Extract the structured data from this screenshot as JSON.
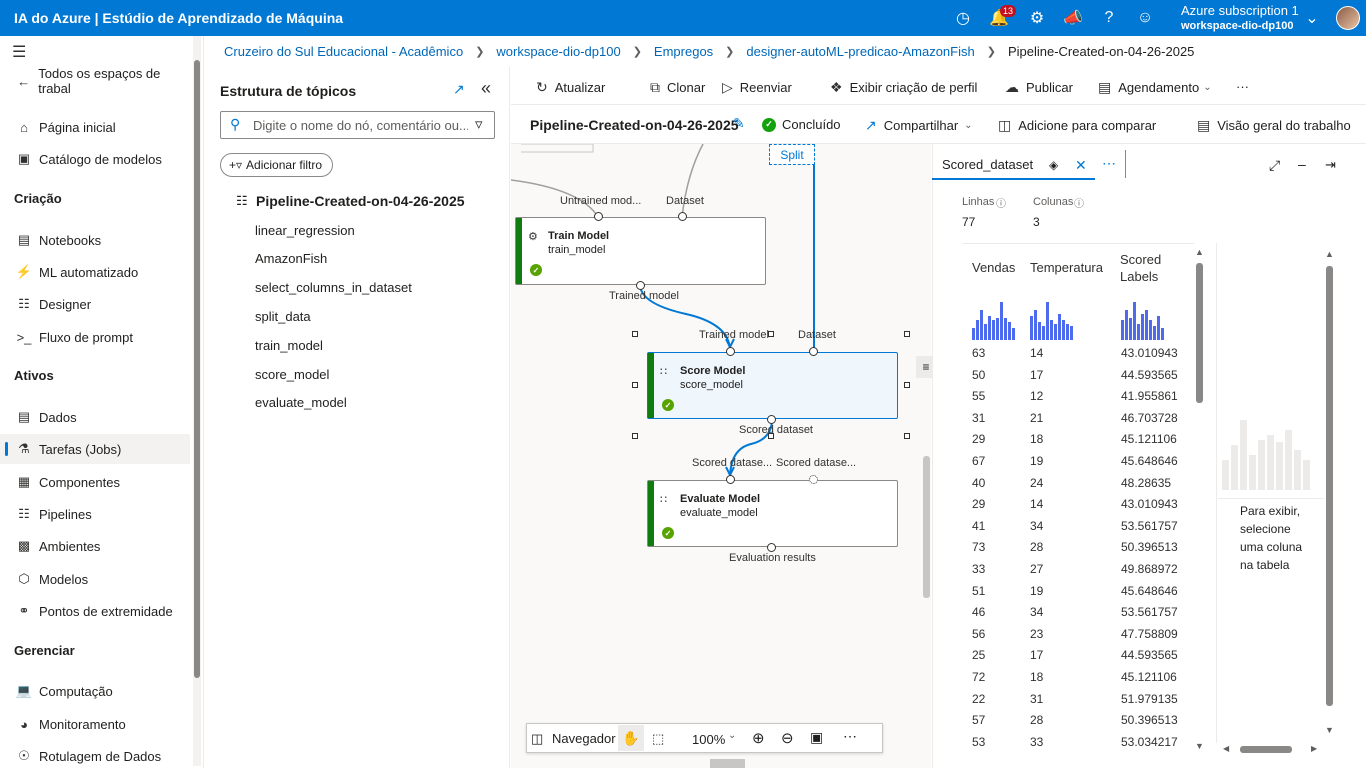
{
  "header": {
    "title": "IA do Azure | Estúdio de Aprendizado de Máquina",
    "notifications_count": "13",
    "subscription": "Azure subscription 1",
    "workspace": "workspace-dio-dp100"
  },
  "nav": {
    "back_label": "Todos os espaços de trabal",
    "home": "Página inicial",
    "catalog": "Catálogo de modelos",
    "section_create": "Criação",
    "notebooks": "Notebooks",
    "automl": "ML automatizado",
    "designer": "Designer",
    "prompt_flow": "Fluxo de prompt",
    "section_assets": "Ativos",
    "data": "Dados",
    "jobs": "Tarefas (Jobs)",
    "components": "Componentes",
    "pipelines": "Pipelines",
    "environments": "Ambientes",
    "models": "Modelos",
    "endpoints": "Pontos de extremidade",
    "section_manage": "Gerenciar",
    "compute": "Computação",
    "monitoring": "Monitoramento",
    "labeling": "Rotulagem de Dados"
  },
  "breadcrumb": {
    "c1": "Cruzeiro do Sul Educacional - Acadêmico",
    "c2": "workspace-dio-dp100",
    "c3": "Empregos",
    "c4": "designer-autoML-predicao-AmazonFish",
    "c5": "Pipeline-Created-on-04-26-2025"
  },
  "outline": {
    "title": "Estrutura de tópicos",
    "search_placeholder": "Digite o nome do nó, comentário ou...",
    "add_filter": "Adicionar filtro",
    "root": "Pipeline-Created-on-04-26-2025",
    "nodes": [
      "linear_regression",
      "AmazonFish",
      "select_columns_in_dataset",
      "split_data",
      "train_model",
      "score_model",
      "evaluate_model"
    ]
  },
  "toolbar": {
    "refresh": "Atualizar",
    "clone": "Clonar",
    "resubmit": "Reenviar",
    "profile": "Exibir criação de perfil",
    "publish": "Publicar",
    "schedule": "Agendamento",
    "more": "···"
  },
  "job": {
    "name": "Pipeline-Created-on-04-26-2025",
    "status": "Concluído",
    "share": "Compartilhar",
    "compare": "Adicione para comparar",
    "overview": "Visão geral do trabalho"
  },
  "canvas": {
    "split_label": "Split",
    "train": {
      "title": "Train Model",
      "sub": "train_model",
      "in1": "Untrained mod...",
      "in2": "Dataset",
      "out": "Trained model"
    },
    "score": {
      "title": "Score Model",
      "sub": "score_model",
      "in1": "Trained model",
      "in2": "Dataset",
      "out": "Scored dataset"
    },
    "evaluate": {
      "title": "Evaluate Model",
      "sub": "evaluate_model",
      "in1": "Scored datase...",
      "in2": "Scored datase...",
      "out": "Evaluation results"
    },
    "navigator": "Navegador",
    "zoom": "100%"
  },
  "dataset": {
    "tab": "Scored_dataset",
    "rows_label": "Linhas",
    "rows": "77",
    "cols_label": "Colunas",
    "cols": "3",
    "headers": [
      "Vendas",
      "Temperatura",
      "Scored Labels"
    ],
    "rows_data": [
      [
        "63",
        "14",
        "43.010943"
      ],
      [
        "50",
        "17",
        "44.593565"
      ],
      [
        "55",
        "12",
        "41.955861"
      ],
      [
        "31",
        "21",
        "46.703728"
      ],
      [
        "29",
        "18",
        "45.121106"
      ],
      [
        "67",
        "19",
        "45.648646"
      ],
      [
        "40",
        "24",
        "48.28635"
      ],
      [
        "29",
        "14",
        "43.010943"
      ],
      [
        "41",
        "34",
        "53.561757"
      ],
      [
        "73",
        "28",
        "50.396513"
      ],
      [
        "33",
        "27",
        "49.868972"
      ],
      [
        "51",
        "19",
        "45.648646"
      ],
      [
        "46",
        "34",
        "53.561757"
      ],
      [
        "56",
        "23",
        "47.758809"
      ],
      [
        "25",
        "17",
        "44.593565"
      ],
      [
        "72",
        "18",
        "45.121106"
      ],
      [
        "22",
        "31",
        "51.979135"
      ],
      [
        "57",
        "28",
        "50.396513"
      ],
      [
        "53",
        "33",
        "53.034217"
      ]
    ],
    "hint": "Para exibir, selecione uma coluna na tabela"
  }
}
